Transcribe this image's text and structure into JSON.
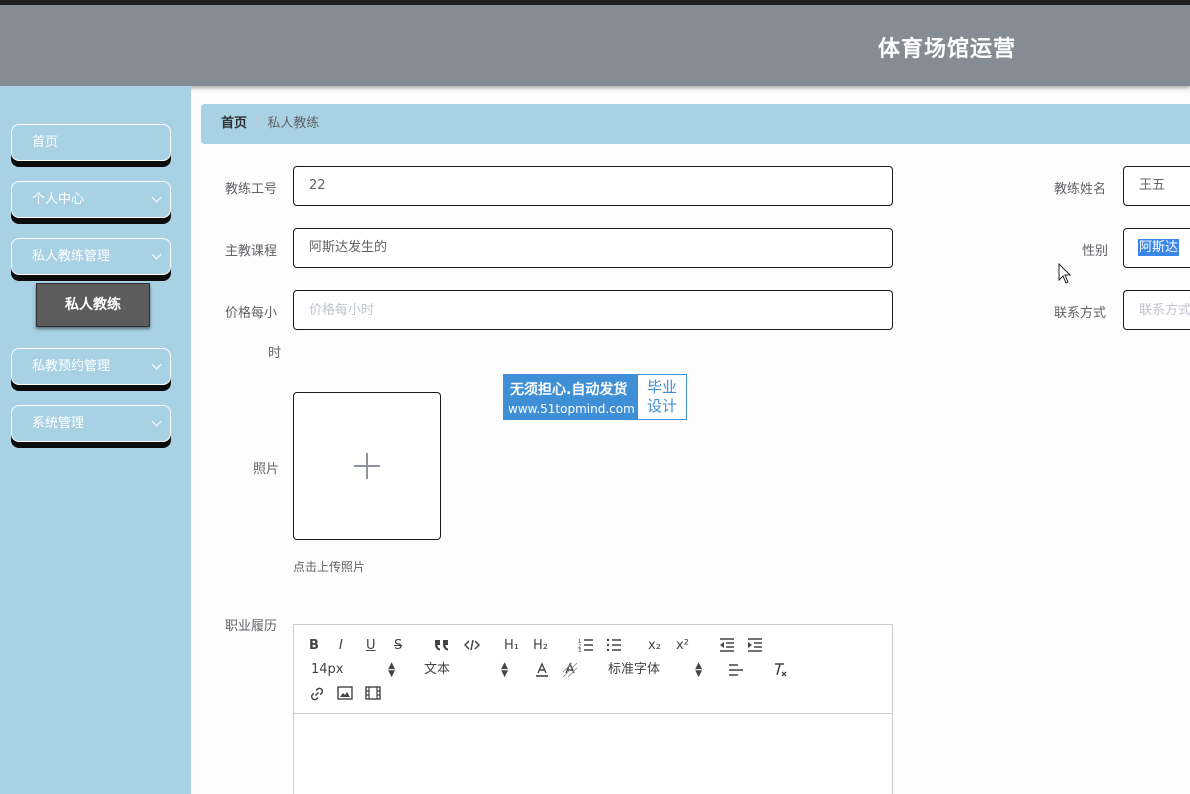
{
  "header": {
    "title": "体育场馆运营"
  },
  "sidebar": {
    "items": [
      {
        "label": "首页"
      },
      {
        "label": "个人中心"
      },
      {
        "label": "私人教练管理"
      },
      {
        "label": "私教预约管理"
      },
      {
        "label": "系统管理"
      }
    ],
    "sub_item": {
      "label": "私人教练"
    }
  },
  "breadcrumb": {
    "home": "首页",
    "separator": "/",
    "current": "私人教练"
  },
  "form": {
    "coach_no": {
      "label": "教练工号",
      "value": "22"
    },
    "coach_name": {
      "label": "教练姓名",
      "value": "王五"
    },
    "main_course": {
      "label": "主教课程",
      "value": "阿斯达发生的"
    },
    "gender": {
      "label": "性别",
      "value": "阿斯达"
    },
    "price": {
      "label_line1": "价格每小",
      "label_line2": "时",
      "placeholder": "价格每小时"
    },
    "contact": {
      "label": "联系方式",
      "placeholder": "联系方式"
    },
    "photo": {
      "label": "照片",
      "tip": "点击上传照片"
    },
    "resume": {
      "label": "职业履历"
    }
  },
  "watermark": {
    "line1": "无须担心.自动发货",
    "line2": "www.51topmind.com",
    "right_line1": "毕业",
    "right_line2": "设计"
  },
  "editor": {
    "toolbar": {
      "bold": "B",
      "italic": "I",
      "underline": "U",
      "strike": "S",
      "h1": "H₁",
      "h2": "H₂",
      "sub": "x₂",
      "sup": "x²",
      "size": "14px",
      "header": "文本",
      "font": "标准字体"
    }
  },
  "icons": [
    "chevron-down-icon",
    "plus-icon",
    "quote-icon",
    "code-icon",
    "ordered-list-icon",
    "bullet-list-icon",
    "outdent-icon",
    "indent-icon",
    "font-color-icon",
    "background-color-icon",
    "align-icon",
    "clear-format-icon",
    "link-icon",
    "image-icon",
    "video-icon",
    "mouse-cursor-icon"
  ],
  "colors": {
    "header_bg": "#858c94",
    "sidebar_bg": "#a8d2e4",
    "breadcrumb_bg": "#a8d2e4",
    "submenu_active_bg": "#5c5c5c",
    "selection": "#3a86e8"
  }
}
